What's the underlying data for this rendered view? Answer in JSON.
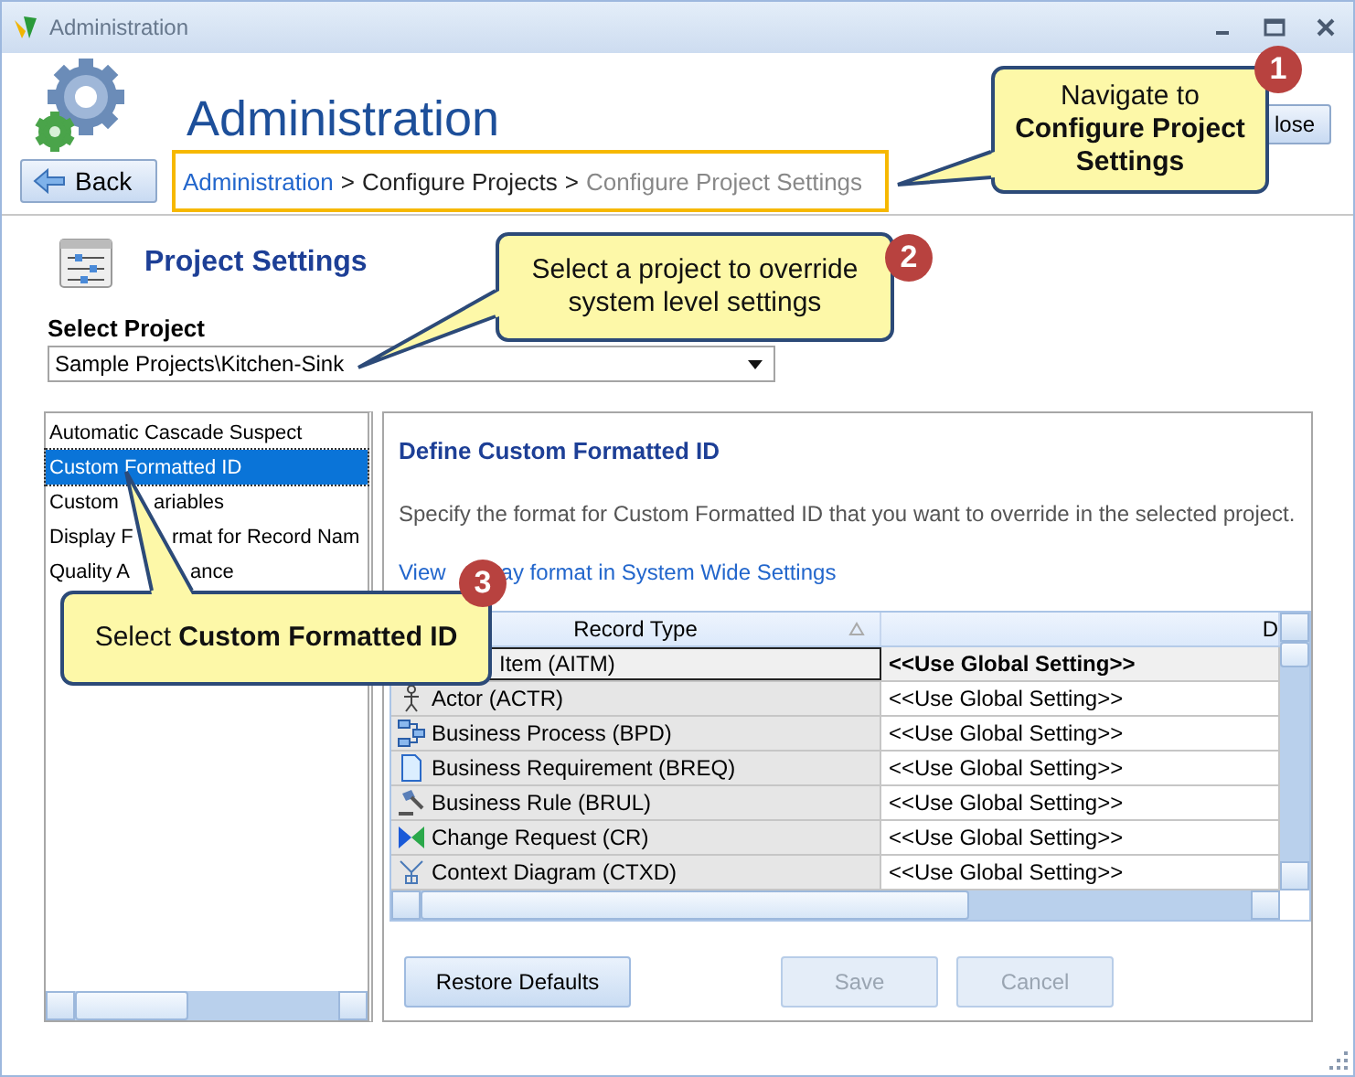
{
  "window": {
    "title": "Administration"
  },
  "header": {
    "title": "Administration",
    "back_button": "Back",
    "close_button": "lose"
  },
  "breadcrumb": [
    {
      "label": "Administration",
      "kind": "link"
    },
    {
      "label": ">",
      "kind": "sep"
    },
    {
      "label": "Configure Projects",
      "kind": "text"
    },
    {
      "label": ">",
      "kind": "sep"
    },
    {
      "label": "Configure Project Settings",
      "kind": "current"
    }
  ],
  "section": {
    "title": "Project Settings"
  },
  "project_select": {
    "label": "Select Project",
    "value": "Sample Projects\\Kitchen-Sink"
  },
  "settings_list": [
    {
      "parts": [
        "Automatic Cascade Suspect"
      ],
      "selected": false
    },
    {
      "parts": [
        "Custom Formatted ID"
      ],
      "selected": true
    },
    {
      "parts": [
        "Custom",
        "ariables"
      ],
      "selected": false
    },
    {
      "parts": [
        "Display F",
        "rmat for Record Nam"
      ],
      "selected": false
    },
    {
      "parts": [
        "Quality A",
        "ance"
      ],
      "selected": false
    }
  ],
  "detail": {
    "title": "Define Custom Formatted ID",
    "description": "Specify the format for Custom Formatted ID that you want to override in the selected project.",
    "link_parts": [
      "View",
      "ay format in System Wide Settings"
    ]
  },
  "table": {
    "columns": [
      "Record Type",
      "D"
    ],
    "rows": [
      {
        "record_type": "Item (AITM)",
        "value": "<<Use Global Setting>>",
        "selected": true
      },
      {
        "kind": "actor",
        "record_type": "Actor (ACTR)",
        "value": "<<Use Global Setting>>",
        "selected": false
      },
      {
        "kind": "process",
        "record_type": "Business Process (BPD)",
        "value": "<<Use Global Setting>>",
        "selected": false
      },
      {
        "kind": "requirement",
        "record_type": "Business Requirement (BREQ)",
        "value": "<<Use Global Setting>>",
        "selected": false
      },
      {
        "kind": "rule",
        "record_type": "Business Rule (BRUL)",
        "value": "<<Use Global Setting>>",
        "selected": false
      },
      {
        "kind": "change",
        "record_type": "Change Request (CR)",
        "value": "<<Use Global Setting>>",
        "selected": false
      },
      {
        "kind": "context",
        "record_type": "Context Diagram (CTXD)",
        "value": "<<Use Global Setting>>",
        "selected": false
      }
    ]
  },
  "buttons": [
    {
      "label": "Restore Defaults",
      "disabled": false
    },
    {
      "label": "Save",
      "disabled": true
    },
    {
      "label": "Cancel",
      "disabled": true
    }
  ],
  "callouts": [
    {
      "number": "1",
      "text": "Navigate to **Configure Project Settings**"
    },
    {
      "number": "2",
      "text": "Select a project to override system level settings"
    },
    {
      "number": "3",
      "text": "Select **Custom Formatted ID**"
    }
  ]
}
